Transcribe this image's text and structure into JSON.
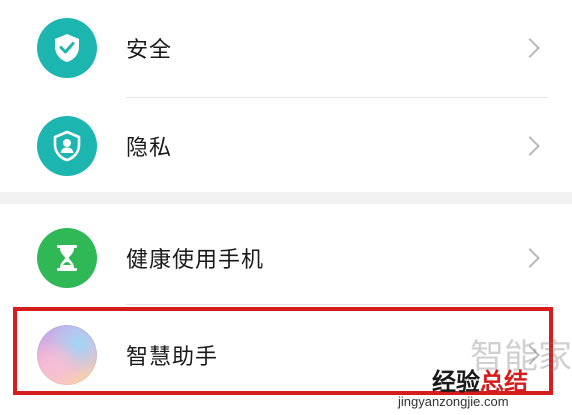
{
  "settings": {
    "group1": [
      {
        "label": "安全",
        "icon": "shield-check-icon",
        "color": "#1db5b0"
      },
      {
        "label": "隐私",
        "icon": "privacy-shield-user-icon",
        "color": "#1db5b0"
      }
    ],
    "group2": [
      {
        "label": "健康使用手机",
        "icon": "hourglass-icon",
        "color": "#2fb855"
      },
      {
        "label": "智慧助手",
        "icon": "smart-assistant-icon"
      }
    ]
  },
  "highlight": {
    "color": "#d61d1d",
    "target": "智慧助手"
  },
  "watermark": {
    "faint_text": "智能家",
    "brand_part1": "经验",
    "brand_part2": "总结",
    "url": "jingyanzongjie.com"
  }
}
